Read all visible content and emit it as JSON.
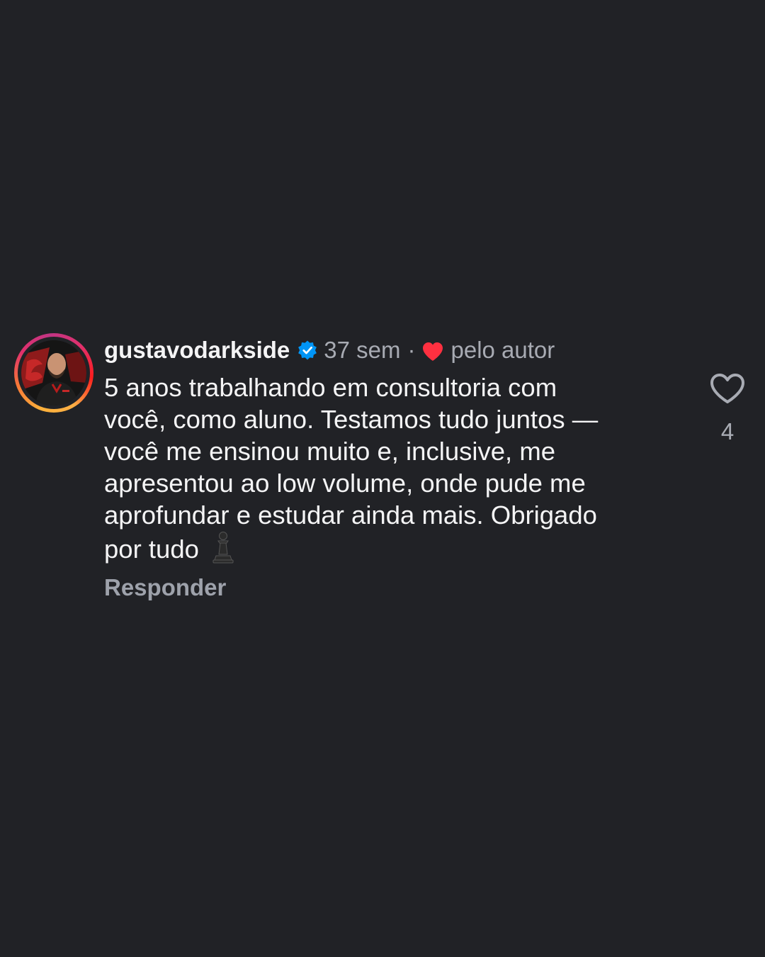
{
  "comment": {
    "username": "gustavodarkside",
    "verified": true,
    "time": "37 sem",
    "separator": "·",
    "liked_by_author_label": "pelo autor",
    "text": "5 anos trabalhando em consultoria com\nvocê, como aluno. Testamos tudo juntos —\nvocê me ensinou muito e, inclusive, me\napresentou ao low volume, onde pude me\naprofundar e estudar ainda mais. Obrigado\npor tudo",
    "emoji": "pawn-icon",
    "reply_label": "Responder",
    "like_count": "4"
  },
  "colors": {
    "background": "#212226",
    "text": "#f4f4f5",
    "secondary_text": "#a8abb3",
    "verified_blue": "#0095f6",
    "heart_red": "#ff3040"
  }
}
